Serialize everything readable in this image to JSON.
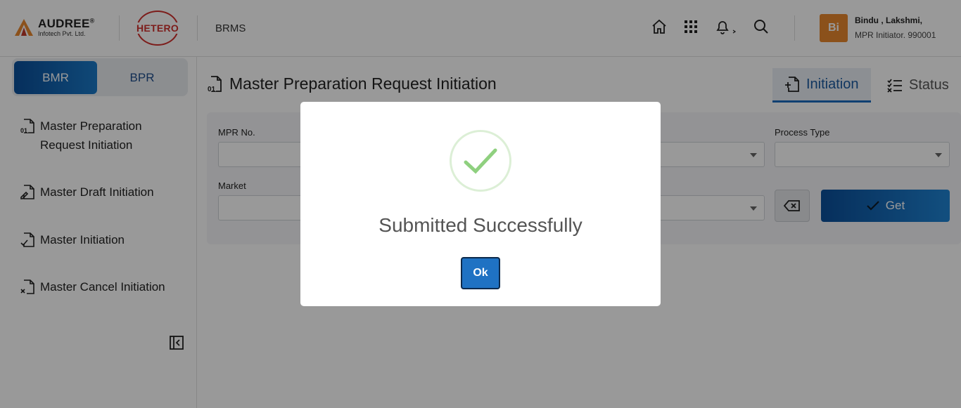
{
  "header": {
    "brand_name": "AUDREE",
    "brand_sub": "Infotech Pvt. Ltd.",
    "partner_logo": "HETERO",
    "app_name": "BRMS",
    "user": {
      "initials": "Bi",
      "name": "Bindu , Lakshmi,",
      "role": "MPR Initiator. 990001"
    },
    "icons": [
      "home-icon",
      "apps-grid-icon",
      "bell-icon",
      "search-icon"
    ]
  },
  "sidebar": {
    "segments": [
      {
        "label": "BMR",
        "active": true
      },
      {
        "label": "BPR",
        "active": false
      }
    ],
    "items": [
      {
        "label": "Master Preparation Request Initiation",
        "icon": "document-01-icon"
      },
      {
        "label": "Master Draft Initiation",
        "icon": "document-draft-icon"
      },
      {
        "label": "Master Initiation",
        "icon": "document-check-icon"
      },
      {
        "label": "Master Cancel Initiation",
        "icon": "document-cancel-icon"
      }
    ]
  },
  "main": {
    "title": "Master Preparation Request Initiation",
    "tabs": [
      {
        "label": "Initiation",
        "active": true
      },
      {
        "label": "Status",
        "active": false
      }
    ],
    "form": {
      "mpr_no_label": "MPR No.",
      "process_type_label": "Process Type",
      "market_label": "Market",
      "get_label": "Get"
    }
  },
  "modal": {
    "title": "Submitted Successfully",
    "ok_label": "Ok"
  },
  "colors": {
    "primary": "#1b6bbf",
    "avatar": "#e8872e",
    "success_check": "#8fd07f",
    "overlay": "rgba(0,0,0,0.4)"
  }
}
